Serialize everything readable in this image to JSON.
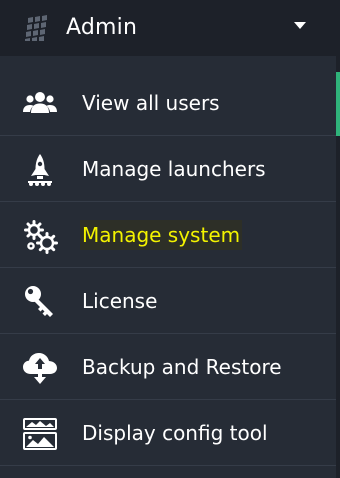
{
  "header": {
    "title": "Admin",
    "logo_icon": "building-icon",
    "caret_icon": "chevron-down-icon"
  },
  "menu": {
    "items": [
      {
        "label": "View all users",
        "icon": "users-icon",
        "active": true
      },
      {
        "label": "Manage launchers",
        "icon": "rocket-icon"
      },
      {
        "label": "Manage system",
        "icon": "gears-icon",
        "highlighted": true
      },
      {
        "label": "License",
        "icon": "key-icon"
      },
      {
        "label": "Backup and Restore",
        "icon": "cloud-upload-download-icon"
      },
      {
        "label": "Display config tool",
        "icon": "display-config-icon"
      }
    ]
  },
  "colors": {
    "background": "#262c36",
    "header_bg": "#1d2129",
    "active_accent": "#2fb37a",
    "highlight_text": "#f3f300"
  }
}
